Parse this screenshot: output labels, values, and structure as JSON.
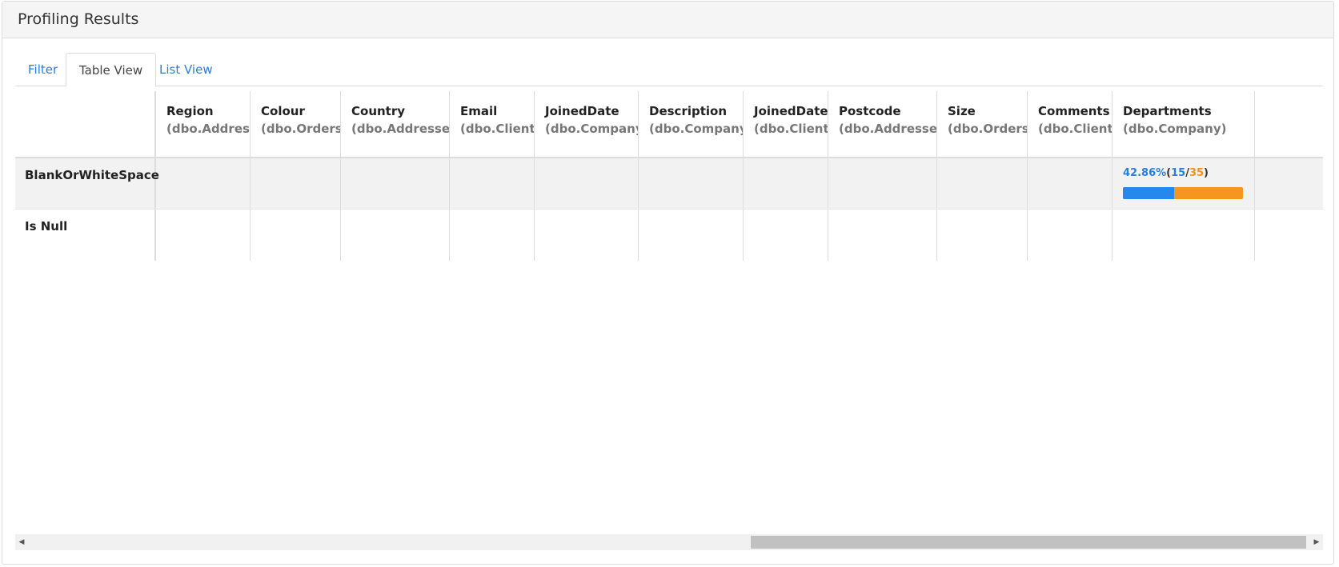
{
  "panel": {
    "title": "Profiling Results"
  },
  "tabs": [
    {
      "label": "Filter",
      "active": false
    },
    {
      "label": "Table View",
      "active": true
    },
    {
      "label": "List View",
      "active": false
    }
  ],
  "table": {
    "columns": [
      {
        "name": "Region",
        "table": "(dbo.Addresses)"
      },
      {
        "name": "Colour",
        "table": "(dbo.Orders)"
      },
      {
        "name": "Country",
        "table": "(dbo.Addresses)"
      },
      {
        "name": "Email",
        "table": "(dbo.Client)"
      },
      {
        "name": "JoinedDate",
        "table": "(dbo.Company)"
      },
      {
        "name": "Description",
        "table": "(dbo.Company)"
      },
      {
        "name": "JoinedDate",
        "table": "(dbo.Client)"
      },
      {
        "name": "Postcode",
        "table": "(dbo.Addresses)"
      },
      {
        "name": "Size",
        "table": "(dbo.Orders)"
      },
      {
        "name": "Comments",
        "table": "(dbo.Client)"
      },
      {
        "name": "Departments",
        "table": "(dbo.Company)"
      }
    ],
    "rows": [
      {
        "label": "BlankOrWhiteSpace",
        "departments_stat": {
          "percent": "42.86%",
          "open": "(",
          "count": "15",
          "sep": "/",
          "total": "35",
          "close": ")",
          "fraction": 0.4286
        }
      },
      {
        "label": "Is Null"
      }
    ]
  },
  "colors": {
    "accent": "#2a7ed8",
    "secondary": "#f0921f"
  },
  "icons": {
    "scroll_left": "triangle-left",
    "scroll_right": "triangle-right"
  }
}
